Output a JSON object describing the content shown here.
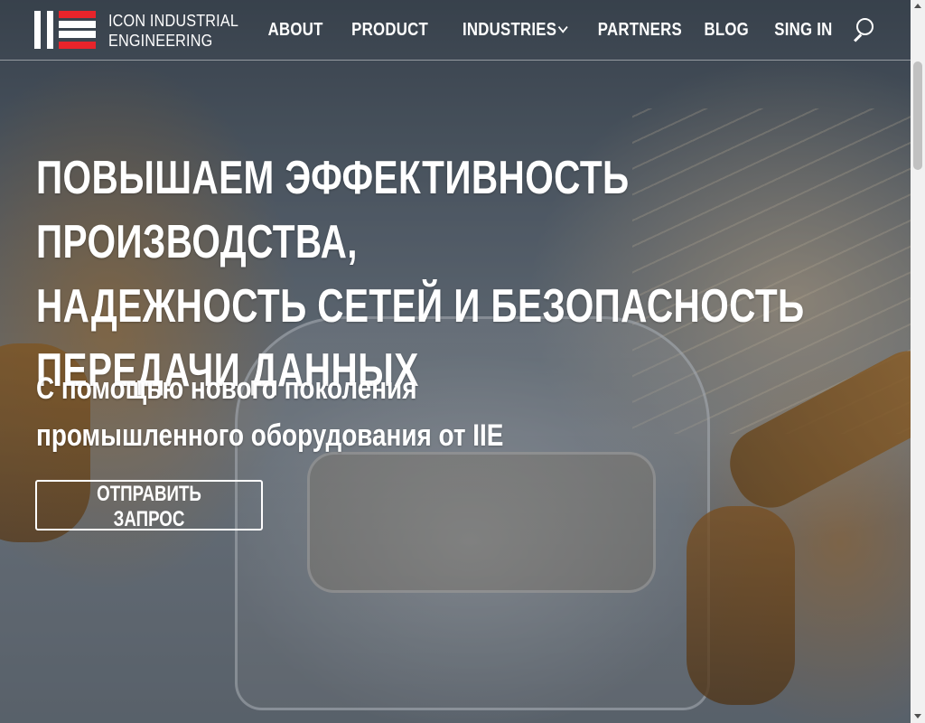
{
  "header": {
    "logo": {
      "line1": "ICON INDUSTRIAL",
      "line2": "ENGINEERING",
      "colors": {
        "red": "#e8242b",
        "white": "#ffffff"
      }
    },
    "nav": [
      {
        "label": "ABOUT"
      },
      {
        "label": "PRODUCT"
      },
      {
        "label": "INDUSTRIES",
        "has_dropdown": true
      },
      {
        "label": "PARTNERS"
      },
      {
        "label": "BLOG"
      },
      {
        "label": "SING IN"
      }
    ],
    "search_icon": "search-icon"
  },
  "hero": {
    "headline_lines": [
      "ПОВЫШАЕМ ЭФФЕКТИВНОСТЬ ПРОИЗВОДСТВА,",
      "НАДЕЖНОСТЬ СЕТЕЙ И БЕЗОПАСНОСТЬ",
      "ПЕРЕДАЧИ ДАННЫХ"
    ],
    "subheadline_lines": [
      "С помощью нового поколения",
      "промышленного оборудования от IIE"
    ],
    "cta_label": "ОТПРАВИТЬ ЗАПРОС"
  }
}
